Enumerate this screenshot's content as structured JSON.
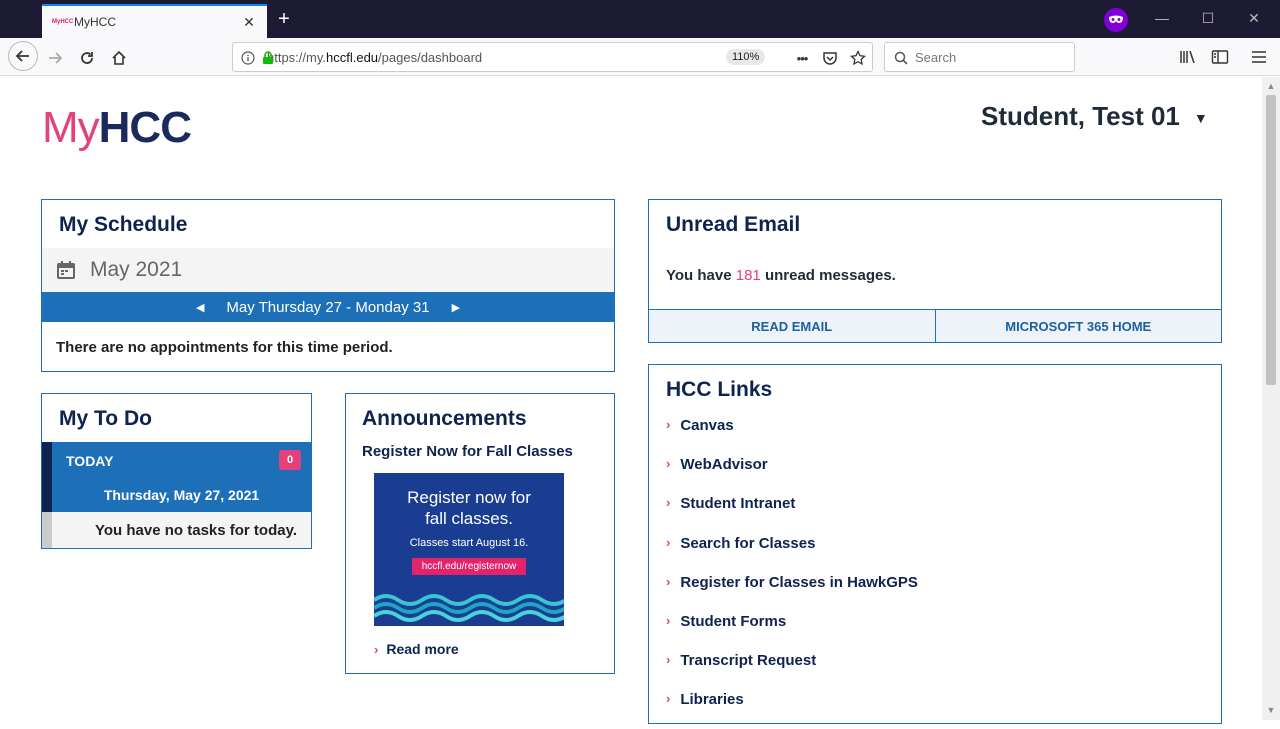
{
  "browser": {
    "tab_title": "MyHCC",
    "favicon_text": "MyHCC",
    "url_prefix": "https://my.",
    "url_domain": "hccfl.edu",
    "url_path": "/pages/dashboard",
    "zoom": "110%",
    "search_placeholder": "Search",
    "new_tab": "+",
    "tab_close": "✕",
    "url_more": "•••"
  },
  "header": {
    "logo_my": "My",
    "logo_hcc": "HCC",
    "user_name": "Student, Test 01",
    "user_caret": "▼"
  },
  "schedule": {
    "title": "My Schedule",
    "month": "May 2021",
    "range": "May Thursday 27 - Monday 31",
    "prev": "◀",
    "next": "▶",
    "empty": "There are no appointments for this time period."
  },
  "email": {
    "title": "Unread Email",
    "msg_prefix": "You have ",
    "count": "181",
    "msg_suffix": " unread messages.",
    "read_btn": "READ EMAIL",
    "m365_btn": "MICROSOFT 365 HOME"
  },
  "todo": {
    "title": "My To Do",
    "today": "TODAY",
    "badge": "0",
    "date": "Thursday, May 27, 2021",
    "empty": "You have no tasks for today."
  },
  "announcements": {
    "title": "Announcements",
    "headline": "Register Now for Fall Classes",
    "promo_line1": "Register now for",
    "promo_line2": "fall classes.",
    "promo_sub": "Classes start August 16.",
    "promo_url": "hccfl.edu/registernow",
    "read_more": "Read more"
  },
  "links": {
    "title": "HCC Links",
    "items": [
      "Canvas",
      "WebAdvisor",
      "Student Intranet",
      "Search for Classes",
      "Register for Classes in HawkGPS",
      "Student Forms",
      "Transcript Request",
      "Libraries"
    ]
  },
  "colors": {
    "accent_blue": "#1d70b7",
    "navy": "#0f2350",
    "pink": "#e4407b"
  }
}
